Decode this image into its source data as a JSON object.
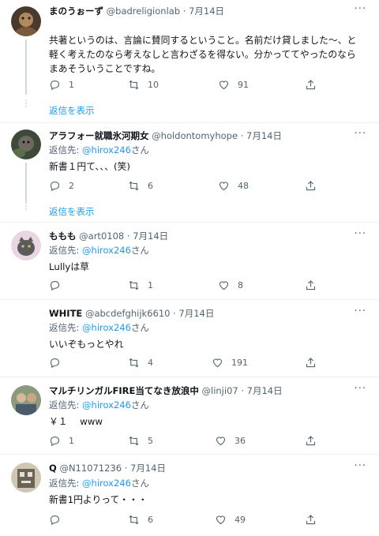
{
  "reply_to_label": "返信先:",
  "reply_to_handle": "@hirox246",
  "reply_to_suffix": "さん",
  "show_replies_label": "返信を表示",
  "colors": {
    "link": "#1d9bf0",
    "muted": "#536471",
    "text": "#0f1419",
    "separator": "#eff3f4"
  },
  "icons": {
    "reply": "reply-icon",
    "retweet": "retweet-icon",
    "like": "like-icon",
    "share": "share-icon",
    "more": "more-icon"
  },
  "tweets": [
    {
      "name": "まのうぉーず",
      "handle": "@badreligionlab",
      "date": "7月14日",
      "text": "共著というのは、言論に賛同するということ。名前だけ貸しました〜、と軽く考えたのなら考えなしと言わざるを得ない。分かっててやったのならまあそういうことですね。",
      "replies": "1",
      "retweets": "10",
      "likes": "91"
    },
    {
      "name": "アラフォー就職氷河期女",
      "handle": "@holdontomyhope",
      "date": "7月14日",
      "text": "新書１円て、、、(笑)",
      "replies": "2",
      "retweets": "6",
      "likes": "48"
    },
    {
      "name": "ももも",
      "handle": "@art0108",
      "date": "7月14日",
      "text": "Lullyは草",
      "replies": "",
      "retweets": "1",
      "likes": "8"
    },
    {
      "name": "WHITE",
      "handle": "@abcdefghijk6610",
      "date": "7月14日",
      "text": "いいぞもっとやれ",
      "replies": "",
      "retweets": "4",
      "likes": "191"
    },
    {
      "name": "マルチリンガルFIRE当てなき放浪中",
      "handle": "@linji07",
      "date": "7月14日",
      "text": "￥１　 www",
      "replies": "1",
      "retweets": "5",
      "likes": "36"
    },
    {
      "name": "Q",
      "handle": "@N11071236",
      "date": "7月14日",
      "text": "新書1円よりって・・・",
      "replies": "",
      "retweets": "6",
      "likes": "49"
    }
  ]
}
